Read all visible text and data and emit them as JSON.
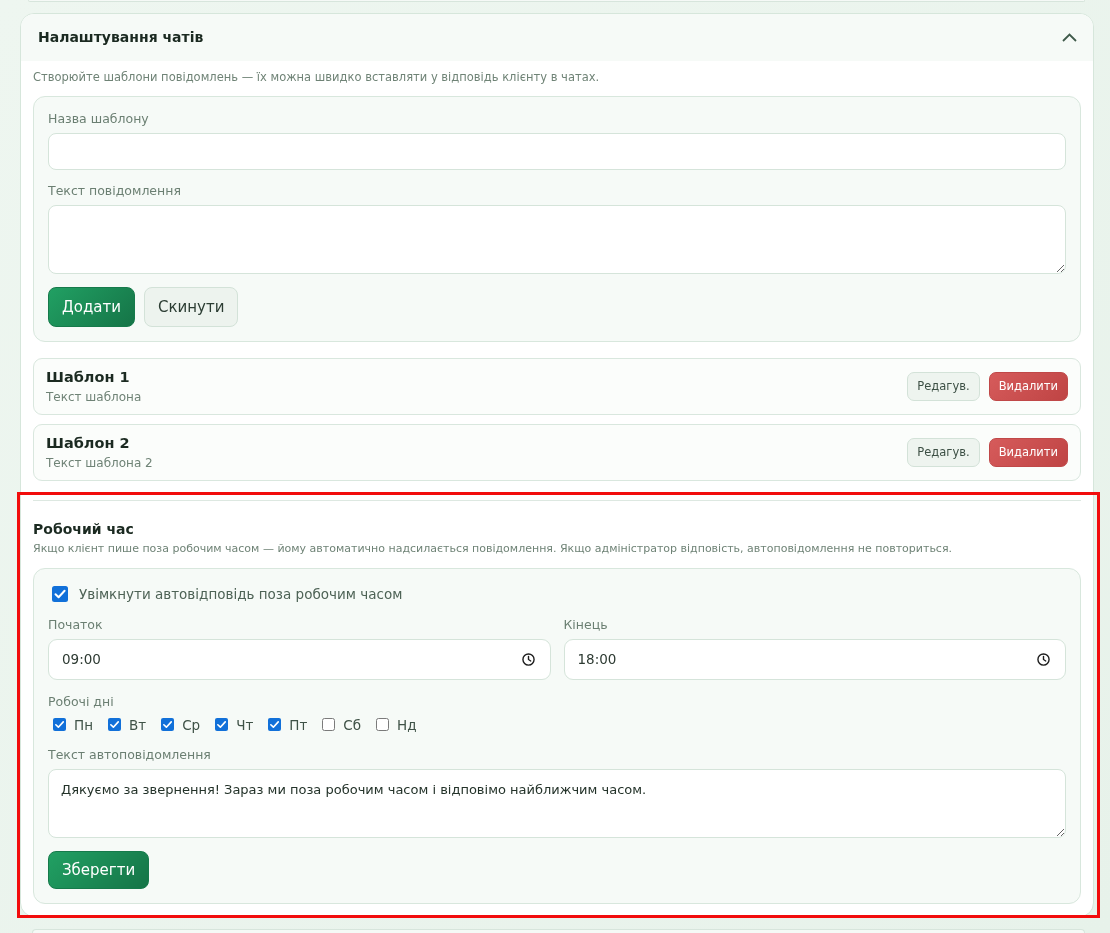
{
  "chat_settings": {
    "title": "Налаштування чатів",
    "expanded": true,
    "description": "Створюйте шаблони повідомлень — їх можна швидко вставляти у відповідь клієнту в чатах.",
    "template_form": {
      "fields": [
        {
          "kind": "input",
          "label": "Назва шаблону"
        },
        {
          "kind": "textarea",
          "label": "Текст повідомлення"
        }
      ],
      "buttons": [
        {
          "kind": "primary",
          "label": "Додати"
        },
        {
          "kind": "secondary",
          "label": "Скинути"
        }
      ]
    },
    "templates": [
      {
        "title": "Шаблон 1",
        "text": "Текст шаблона",
        "actions": [
          {
            "kind": "edit",
            "label": "Редагув."
          },
          {
            "kind": "delete",
            "label": "Видалити"
          }
        ]
      },
      {
        "title": "Шаблон 2",
        "text": "Текст шаблона 2",
        "actions": [
          {
            "kind": "edit",
            "label": "Редагув."
          },
          {
            "kind": "delete",
            "label": "Видалити"
          }
        ]
      }
    ]
  },
  "working_hours": {
    "title": "Робочий час",
    "description": "Якщо клієнт пише поза робочим часом — йому автоматично надсилається повідомлення. Якщо адміністратор відповість, автоповідомлення не повториться.",
    "auto_reply": {
      "label": "Увімкнути автовідповідь поза робочим часом",
      "checked": true
    },
    "times": [
      {
        "label": "Початок",
        "value": "09:00"
      },
      {
        "label": "Кінець",
        "value": "18:00"
      }
    ],
    "days_label": "Робочі дні",
    "days": [
      {
        "label": "Пн",
        "checked": true
      },
      {
        "label": "Вт",
        "checked": true
      },
      {
        "label": "Ср",
        "checked": true
      },
      {
        "label": "Чт",
        "checked": true
      },
      {
        "label": "Пт",
        "checked": true
      },
      {
        "label": "Сб",
        "checked": false
      },
      {
        "label": "Нд",
        "checked": false
      }
    ],
    "message": {
      "label": "Текст автоповідомлення",
      "value": "Дякуємо за звернення! Зараз ми поза робочим часом і відповімо найближчим часом."
    },
    "save_button": "Зберегти"
  }
}
